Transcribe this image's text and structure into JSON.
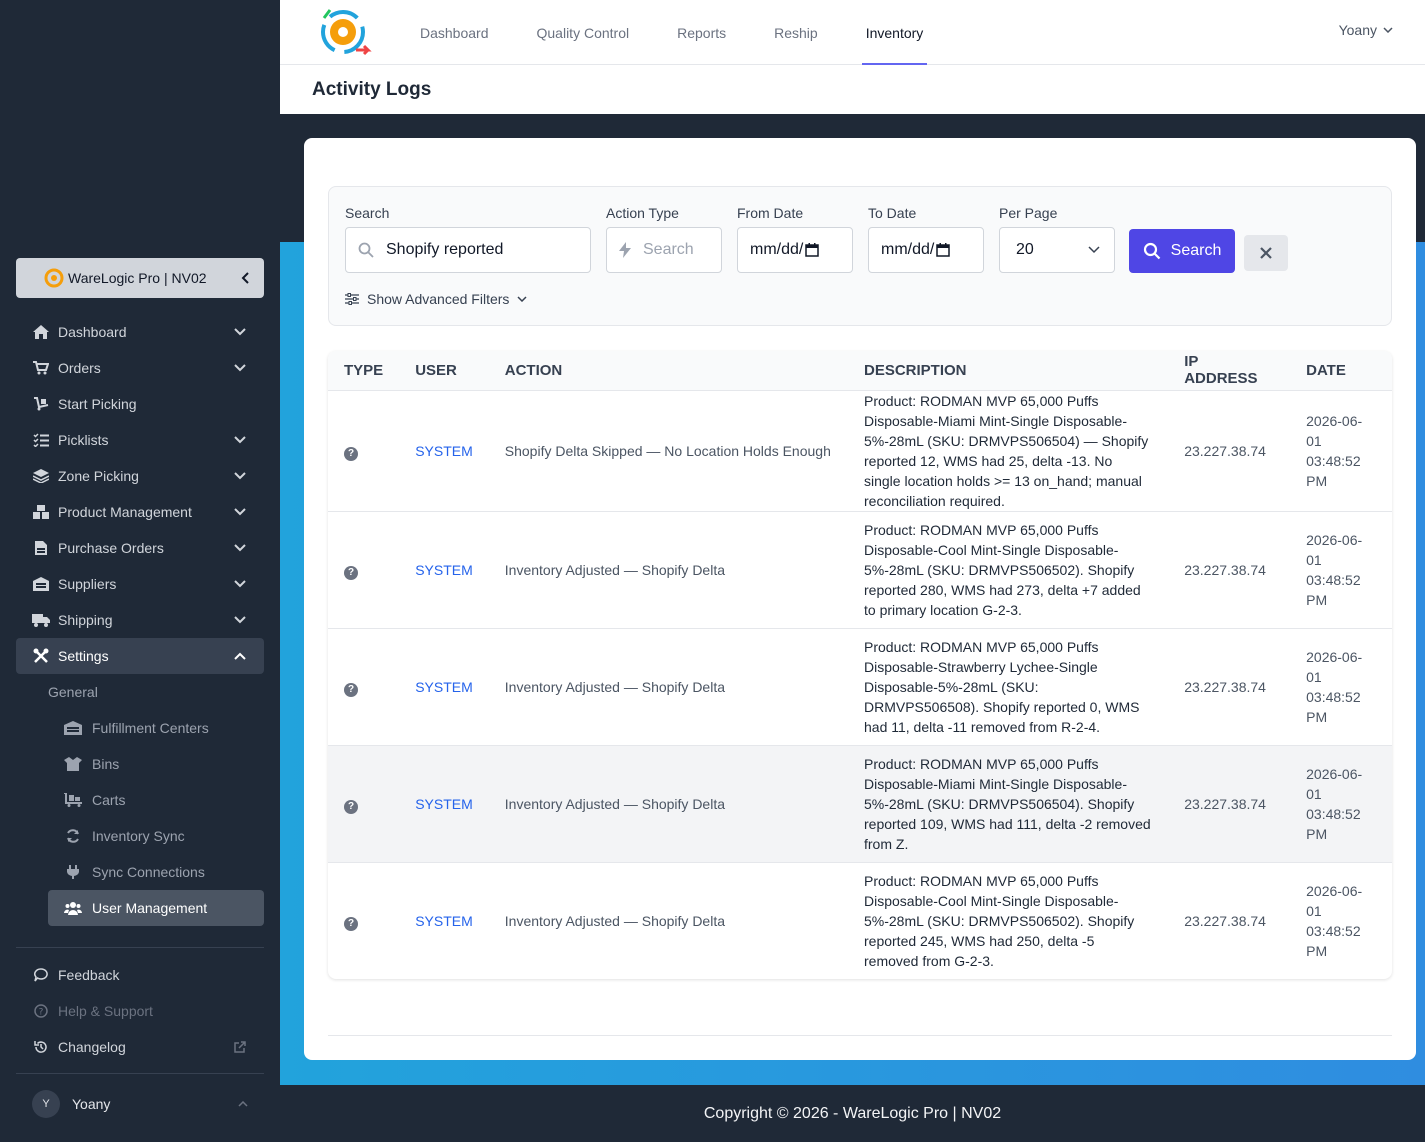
{
  "sidebar": {
    "workspace": "WareLogic Pro | NV02",
    "items": [
      {
        "label": "Dashboard",
        "icon": "home-icon"
      },
      {
        "label": "Orders",
        "icon": "cart-icon"
      },
      {
        "label": "Start Picking",
        "icon": "dolly-icon"
      },
      {
        "label": "Picklists",
        "icon": "list-check-icon"
      },
      {
        "label": "Zone Picking",
        "icon": "layers-icon"
      },
      {
        "label": "Product Management",
        "icon": "boxes-icon"
      },
      {
        "label": "Purchase Orders",
        "icon": "file-invoice-icon"
      },
      {
        "label": "Suppliers",
        "icon": "warehouse-icon"
      },
      {
        "label": "Shipping",
        "icon": "truck-icon"
      },
      {
        "label": "Settings",
        "icon": "tools-icon"
      }
    ],
    "settings_group": "General",
    "settings_items": [
      {
        "label": "Fulfillment Centers",
        "icon": "warehouse-icon"
      },
      {
        "label": "Bins",
        "icon": "box-open-icon"
      },
      {
        "label": "Carts",
        "icon": "cart-flatbed-icon"
      },
      {
        "label": "Inventory Sync",
        "icon": "sync-icon"
      },
      {
        "label": "Sync Connections",
        "icon": "plug-icon"
      },
      {
        "label": "User Management",
        "icon": "users-icon"
      }
    ],
    "bottom": {
      "feedback": "Feedback",
      "help": "Help & Support",
      "changelog": "Changelog"
    },
    "user": {
      "initial": "Y",
      "name": "Yoany"
    }
  },
  "topnav": {
    "tabs": [
      "Dashboard",
      "Quality Control",
      "Reports",
      "Reship",
      "Inventory"
    ],
    "active_tab": "Inventory",
    "user": "Yoany"
  },
  "page": {
    "title": "Activity Logs"
  },
  "filters": {
    "search_label": "Search",
    "search_value": "Shopify reported",
    "action_type_label": "Action Type",
    "action_type_placeholder": "Search",
    "from_date_label": "From Date",
    "from_date_value": "mm/dd/",
    "to_date_label": "To Date",
    "to_date_value": "mm/dd/",
    "per_page_label": "Per Page",
    "per_page_value": "20",
    "search_button": "Search",
    "advanced": "Show Advanced Filters"
  },
  "table": {
    "headers": [
      "TYPE",
      "USER",
      "ACTION",
      "DESCRIPTION",
      "IP ADDRESS",
      "DATE"
    ],
    "rows": [
      {
        "user": "SYSTEM",
        "action": "Shopify Delta Skipped — No Location Holds Enough",
        "description": "Product: RODMAN MVP 65,000 Puffs Disposable-Miami Mint-Single Disposable-5%-28mL (SKU: DRMVPS506504) — Shopify reported 12, WMS had 25, delta -13. No single location holds >= 13 on_hand; manual reconciliation required.",
        "ip": "23.227.38.74",
        "date": "2026-06-01 03:48:52 PM"
      },
      {
        "user": "SYSTEM",
        "action": "Inventory Adjusted — Shopify Delta",
        "description": "Product: RODMAN MVP 65,000 Puffs Disposable-Cool Mint-Single Disposable-5%-28mL (SKU: DRMVPS506502). Shopify reported 280, WMS had 273, delta +7 added to primary location G-2-3.",
        "ip": "23.227.38.74",
        "date": "2026-06-01 03:48:52 PM"
      },
      {
        "user": "SYSTEM",
        "action": "Inventory Adjusted — Shopify Delta",
        "description": "Product: RODMAN MVP 65,000 Puffs Disposable-Strawberry Lychee-Single Disposable-5%-28mL (SKU: DRMVPS506508). Shopify reported 0, WMS had 11, delta -11 removed from R-2-4.",
        "ip": "23.227.38.74",
        "date": "2026-06-01 03:48:52 PM"
      },
      {
        "user": "SYSTEM",
        "action": "Inventory Adjusted — Shopify Delta",
        "description": "Product: RODMAN MVP 65,000 Puffs Disposable-Miami Mint-Single Disposable-5%-28mL (SKU: DRMVPS506504). Shopify reported 109, WMS had 111, delta -2 removed from Z.",
        "ip": "23.227.38.74",
        "date": "2026-06-01 03:48:52 PM"
      },
      {
        "user": "SYSTEM",
        "action": "Inventory Adjusted — Shopify Delta",
        "description": "Product: RODMAN MVP 65,000 Puffs Disposable-Cool Mint-Single Disposable-5%-28mL (SKU: DRMVPS506502). Shopify reported 245, WMS had 250, delta -5 removed from G-2-3.",
        "ip": "23.227.38.74",
        "date": "2026-06-01 03:48:52 PM"
      }
    ]
  },
  "footer": {
    "text": "Copyright © 2026 - WareLogic Pro | NV02"
  },
  "colors": {
    "primary": "#4f46e5",
    "link": "#2563eb",
    "sidebar_bg": "#1f2937"
  }
}
